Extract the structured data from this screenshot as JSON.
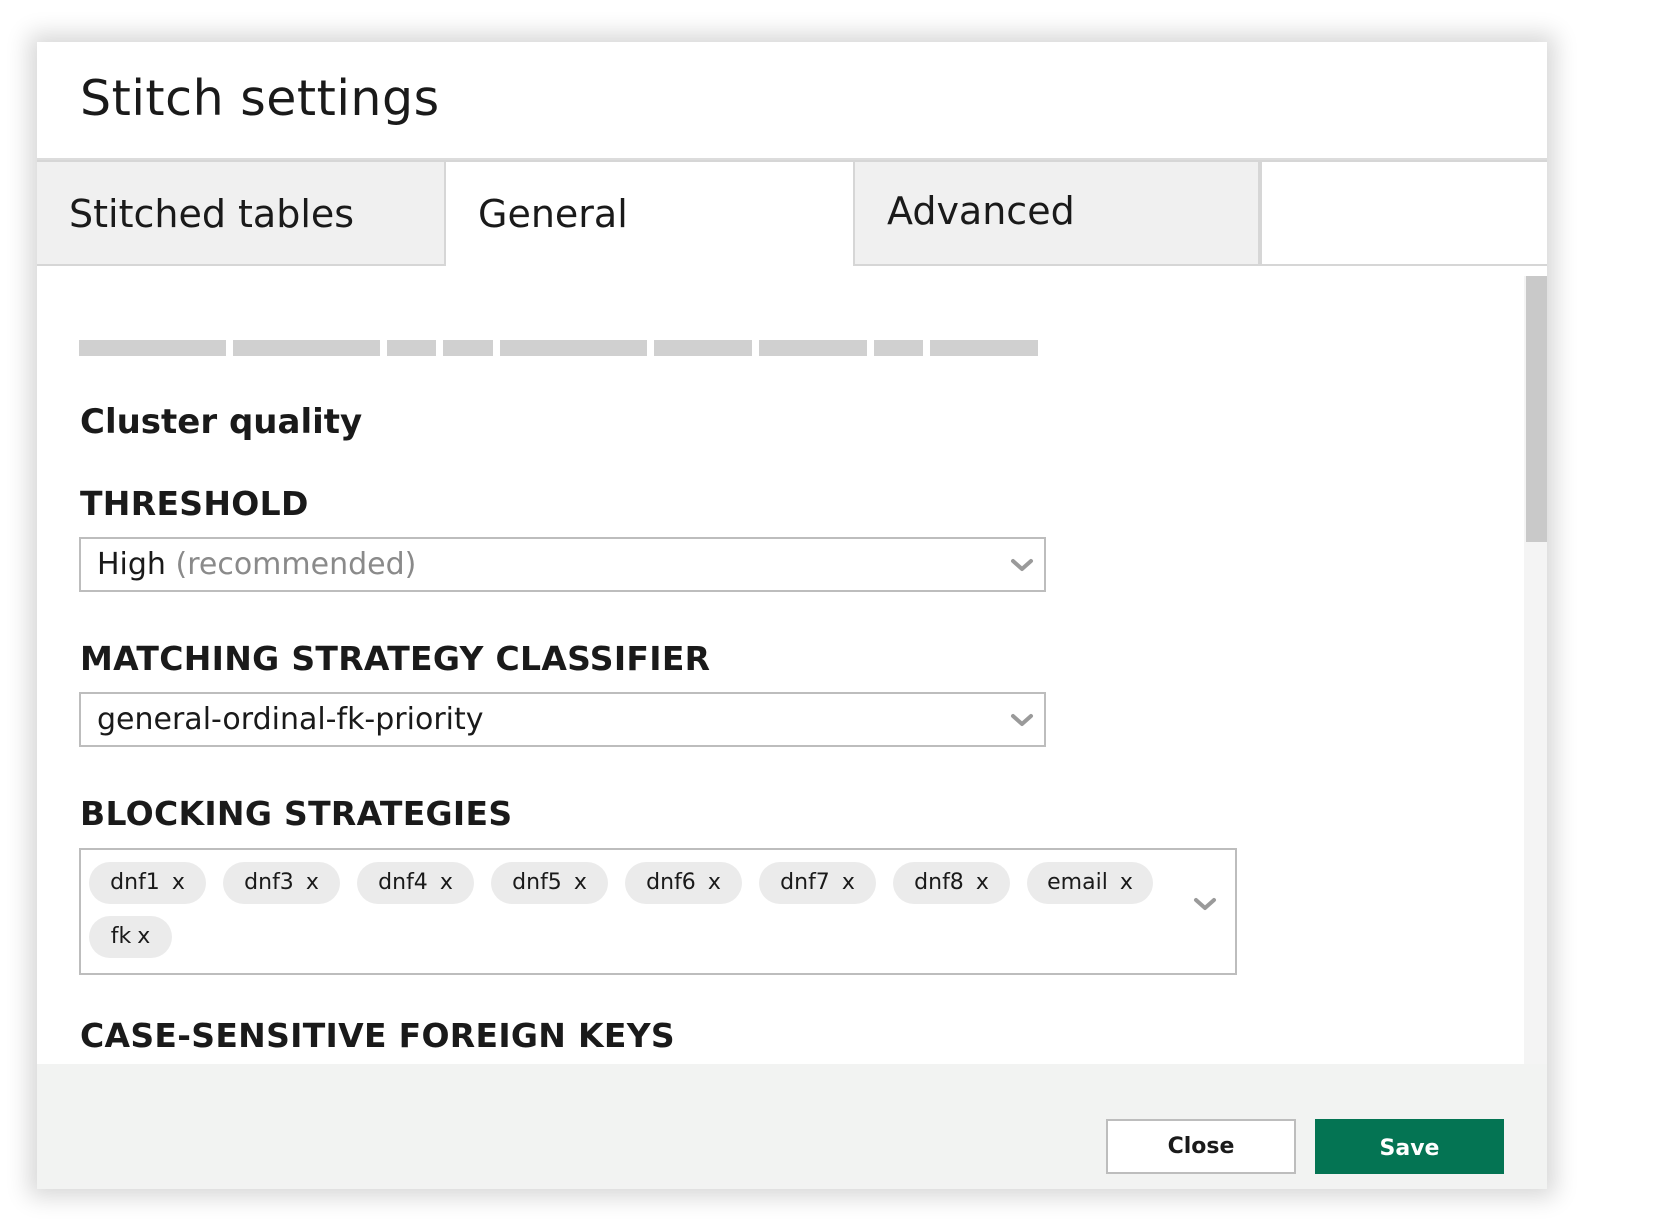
{
  "dialog": {
    "title": "Stitch settings"
  },
  "tabs": [
    {
      "label": "Stitched tables",
      "active": false
    },
    {
      "label": "General",
      "active": true
    },
    {
      "label": "Advanced",
      "active": false
    }
  ],
  "content": {
    "section_heading": "Cluster quality",
    "threshold": {
      "label": "THRESHOLD",
      "value": "High",
      "hint": "(recommended)"
    },
    "classifier": {
      "label": "MATCHING STRATEGY CLASSIFIER",
      "value": "general-ordinal-fk-priority"
    },
    "blocking": {
      "label": "BLOCKING STRATEGIES",
      "remove_glyph": "x",
      "chips": [
        "dnf1",
        "dnf3",
        "dnf4",
        "dnf5",
        "dnf6",
        "dnf7",
        "dnf8",
        "email",
        "fk"
      ]
    },
    "case_sensitive": {
      "label": "CASE-SENSITIVE FOREIGN KEYS"
    }
  },
  "footer": {
    "close_label": "Close",
    "save_label": "Save"
  },
  "icons": {
    "dropdown": "chevron-down-icon"
  },
  "colors": {
    "accent": "#047453",
    "tab_inactive_bg": "#f0f0f0",
    "footer_bg": "#f2f3f2",
    "chip_bg": "#ebebeb"
  }
}
